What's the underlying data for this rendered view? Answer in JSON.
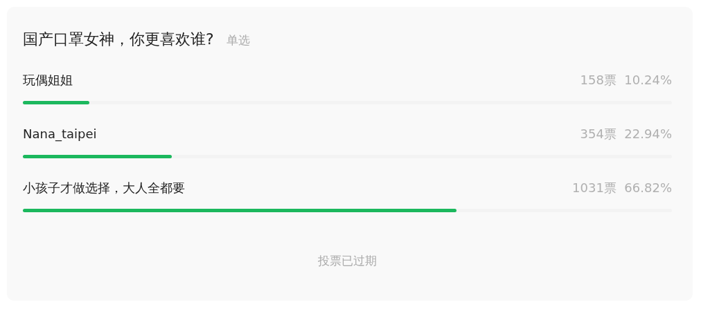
{
  "poll": {
    "title": "国产口罩女神，你更喜欢谁?",
    "mode": "单选",
    "options": [
      {
        "label": "玩偶姐姐",
        "votes": "158票",
        "percent": "10.24%",
        "level": 0.1024
      },
      {
        "label": "Nana_taipei",
        "votes": "354票",
        "percent": "22.94%",
        "level": 0.2294
      },
      {
        "label": "小孩子才做选择，大人全都要",
        "votes": "1031票",
        "percent": "66.82%",
        "level": 0.6682
      }
    ],
    "status": "投票已过期"
  }
}
